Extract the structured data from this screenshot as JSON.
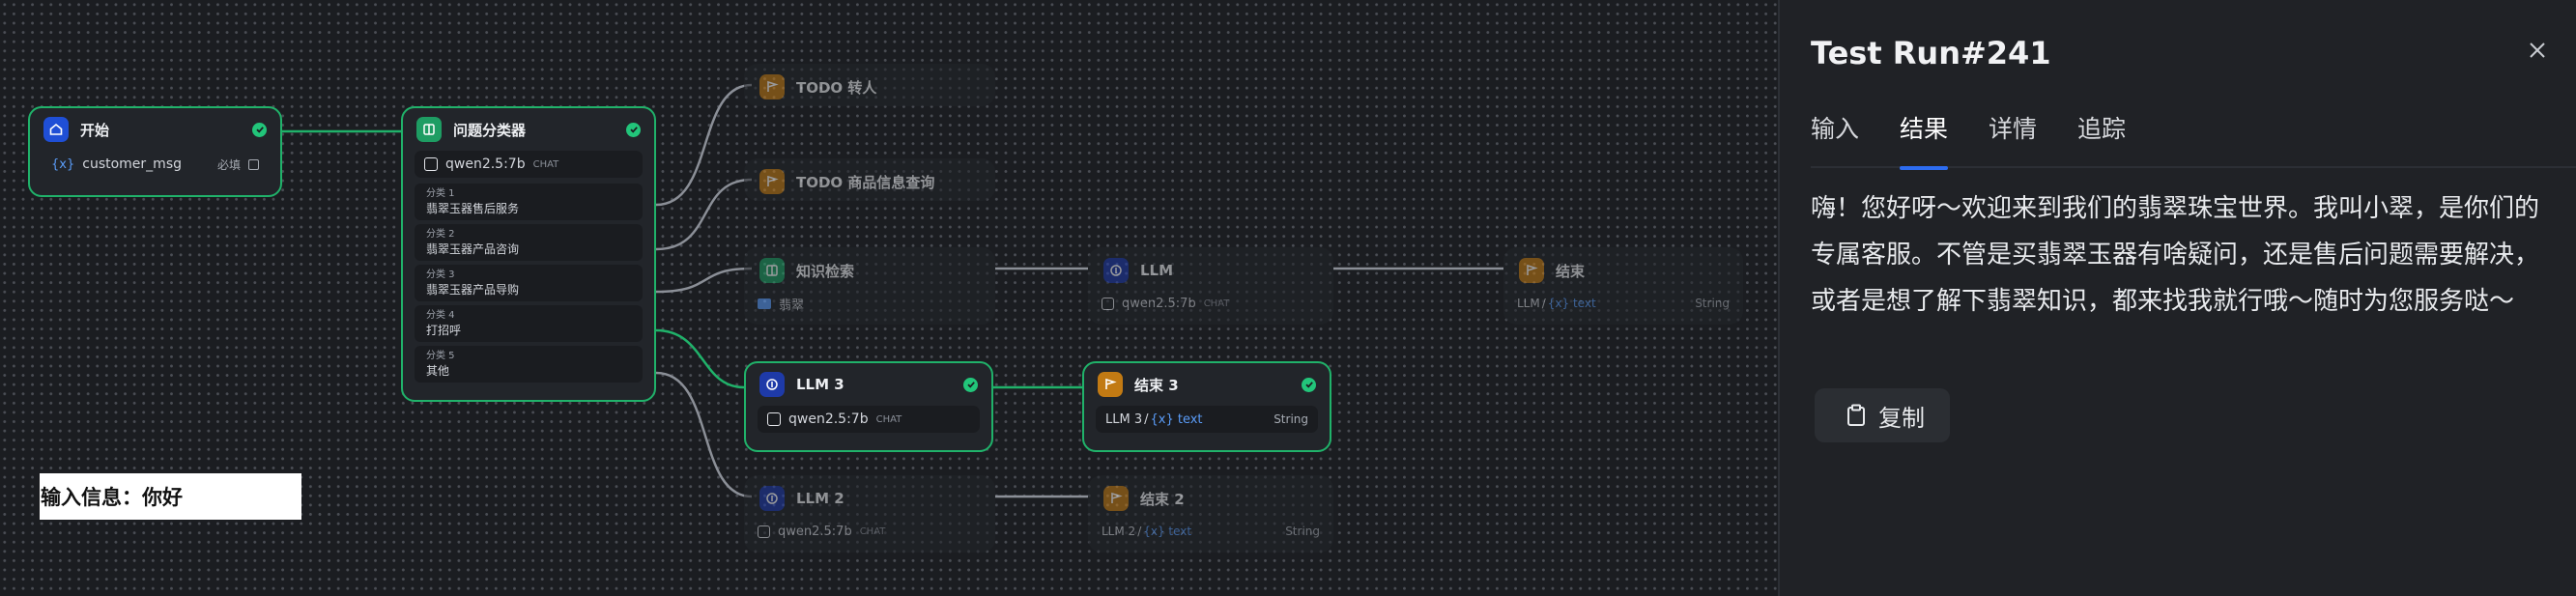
{
  "canvas": {
    "start_node": {
      "title": "开始",
      "var_name": "customer_msg",
      "required_label": "必填"
    },
    "classifier_node": {
      "title": "问题分类器",
      "model": "qwen2.5:7b",
      "model_tag": "CHAT",
      "classes": [
        {
          "key": "分类 1",
          "value": "翡翠玉器售后服务"
        },
        {
          "key": "分类 2",
          "value": "翡翠玉器产品咨询"
        },
        {
          "key": "分类 3",
          "value": "翡翠玉器产品导购"
        },
        {
          "key": "分类 4",
          "value": "打招呼"
        },
        {
          "key": "分类 5",
          "value": "其他"
        }
      ]
    },
    "todo1_node": {
      "title": "TODO 转人"
    },
    "todo2_node": {
      "title": "TODO 商品信息查询"
    },
    "knowledge_node": {
      "title": "知识检索",
      "dataset": "翡翠"
    },
    "llm_node": {
      "title": "LLM",
      "model": "qwen2.5:7b",
      "model_tag": "CHAT"
    },
    "end_node": {
      "title": "结束",
      "source": "LLM",
      "var": "{x} text",
      "type": "String"
    },
    "llm3_node": {
      "title": "LLM 3",
      "model": "qwen2.5:7b",
      "model_tag": "CHAT"
    },
    "end3_node": {
      "title": "结束 3",
      "source": "LLM 3",
      "var": "{x} text",
      "type": "String"
    },
    "llm2_node": {
      "title": "LLM 2",
      "model": "qwen2.5:7b",
      "model_tag": "CHAT"
    },
    "end2_node": {
      "title": "结束 2",
      "source": "LLM 2",
      "var": "{x} text",
      "type": "String"
    },
    "input_note": "输入信息：你好",
    "var_prefix": "{x}",
    "slash": "/"
  },
  "panel": {
    "title": "Test Run#241",
    "tabs": [
      {
        "label": "输入",
        "active": false
      },
      {
        "label": "结果",
        "active": true
      },
      {
        "label": "详情",
        "active": false
      },
      {
        "label": "追踪",
        "active": false
      }
    ],
    "result_text": "嗨！您好呀～欢迎来到我们的翡翠珠宝世界。我叫小翠，是你们的专属客服。不管是买翡翠玉器有啥疑问，还是售后问题需要解决，或者是想了解下翡翠知识，都来找我就行哦～随时为您服务哒～",
    "copy_label": "复制"
  },
  "colors": {
    "success": "#22c57a",
    "active_edge": "#20b26a",
    "accent": "#2d6cf0",
    "variable": "#5a9cf8"
  }
}
